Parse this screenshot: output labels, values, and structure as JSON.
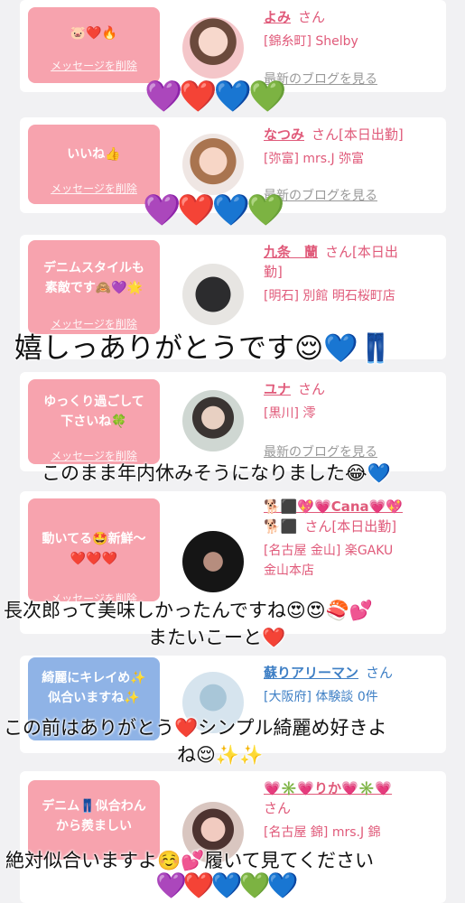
{
  "delete_label": "メッセージを削除",
  "blog_label": "最新のブログを見る",
  "san_label": "さん",
  "cards": [
    {
      "message": "🐷❤️🔥",
      "name": "よみ",
      "tag": "",
      "shop": "[錦糸町] Shelby"
    },
    {
      "message": "いいね👍",
      "name": "なつみ",
      "tag": "[本日出勤]",
      "shop": "[弥富] mrs.J 弥富"
    },
    {
      "message_lines": [
        "デニムスタイルも",
        "素敵です🙈💜🌟"
      ],
      "name": "九条　蘭",
      "tag": "[本日出",
      "tag2": "勤]",
      "shop": "[明石] 別館 明石桜町店"
    },
    {
      "message_lines": [
        "ゆっくり過ごして",
        "下さいね🍀"
      ],
      "name": "ユナ",
      "tag": "",
      "shop": "[黒川] 澪"
    },
    {
      "message_lines": [
        "動いてる🤩新鮮〜",
        "❤️❤️❤️"
      ],
      "name_line1": "🐕⬛💖💗Cana💗💖",
      "name_line2": "🐕⬛",
      "tag": "[本日出勤]",
      "shop_lines": [
        "[名古屋 金山] 楽GAKU",
        "金山本店"
      ]
    },
    {
      "message_lines": [
        "綺麗にキレイめ✨",
        "似合いますね✨"
      ],
      "name": "蘇りアリーマン",
      "tag": "",
      "shop": "[大阪府] 体験談 0件"
    },
    {
      "message_lines": [
        "デニム👖似合わん",
        "から羨ましい"
      ],
      "name": "💗✳️💗りか💗✳️💗",
      "tag": "",
      "shop": "[名古屋 錦] mrs.J 錦"
    }
  ],
  "overlays": {
    "line1": "嬉しっありがとうです😌💙👖",
    "line2": "このまま年内休みそうになりました😂💙",
    "line3": "長次郎って美味しかったんですね😍😍🍣💕",
    "line4": "またいこーと❤️",
    "line5": "この前はありがとう❤️シンプル綺麗め好きよ",
    "line6": "ね😌✨✨",
    "line7": "絶対似合いますよ☺️💕履いて見てください"
  },
  "hearts": {
    "row1": "💜❤️💙💚",
    "row2": "💜❤️💙💚",
    "row3": "💜❤️💙💚💙"
  }
}
